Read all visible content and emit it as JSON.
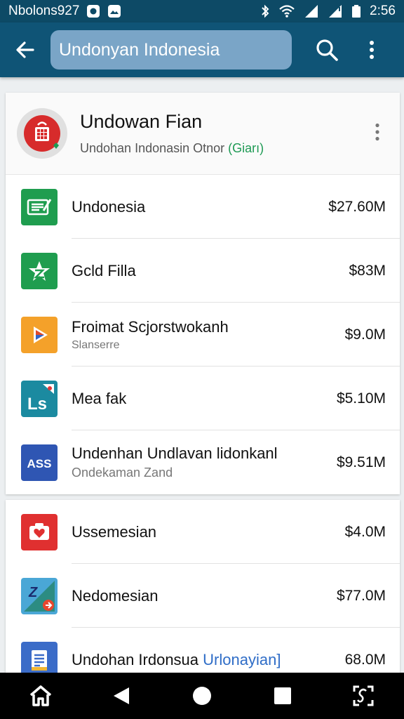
{
  "status_bar": {
    "carrier": "Nbolons927",
    "time": "2:56",
    "icons": [
      "notification-icon",
      "photo-icon",
      "bluetooth-icon",
      "wifi-icon",
      "signal-icon",
      "signal-icon",
      "battery-icon"
    ]
  },
  "app_bar": {
    "search_text": "Undonyan Indonesia",
    "icons": [
      "back-arrow-icon",
      "search-icon",
      "more-vert-icon"
    ],
    "color": "#0f5476"
  },
  "header": {
    "title": "Undowan Fian",
    "subtitle": "Undohan Indonasin Otnor",
    "subtitle_accent": "(Giarı)"
  },
  "list1": [
    {
      "title": "Undonesia",
      "subtitle": "",
      "price": "$27.60M",
      "icon": "green-note-icon"
    },
    {
      "title": "Gcld Filla",
      "subtitle": "",
      "price": "$83M",
      "icon": "green-star-icon"
    },
    {
      "title": "Froimat Scjorstwokanh",
      "subtitle": "Slanserre",
      "price": "$9.0M",
      "icon": "play-icon"
    },
    {
      "title": "Mea fak",
      "subtitle": "",
      "price": "$5.10M",
      "icon": "ls-icon"
    },
    {
      "title": "Undenhan Undlavan lidonkanl",
      "subtitle": "Ondekaman Zand",
      "price": "$9.51M",
      "icon": "ass-icon"
    }
  ],
  "list2": [
    {
      "title": "Ussemesian",
      "subtitle": "",
      "price": "$4.0M",
      "icon": "red-heart-icon"
    },
    {
      "title": "Nedomesian",
      "subtitle": "",
      "price": "$77.0M",
      "icon": "z-badge-icon"
    },
    {
      "title": "Undohan Irdonsua",
      "title_accent": "Urlonayian]",
      "subtitle": "",
      "price": "68.0M",
      "icon": "document-icon"
    }
  ],
  "nav_bar": {
    "icons": [
      "home-icon",
      "back-icon",
      "home-circle-icon",
      "recents-icon",
      "screenshot-icon"
    ]
  },
  "ls_label": "Ls",
  "ass_label": "ASS",
  "z_label": "Z"
}
